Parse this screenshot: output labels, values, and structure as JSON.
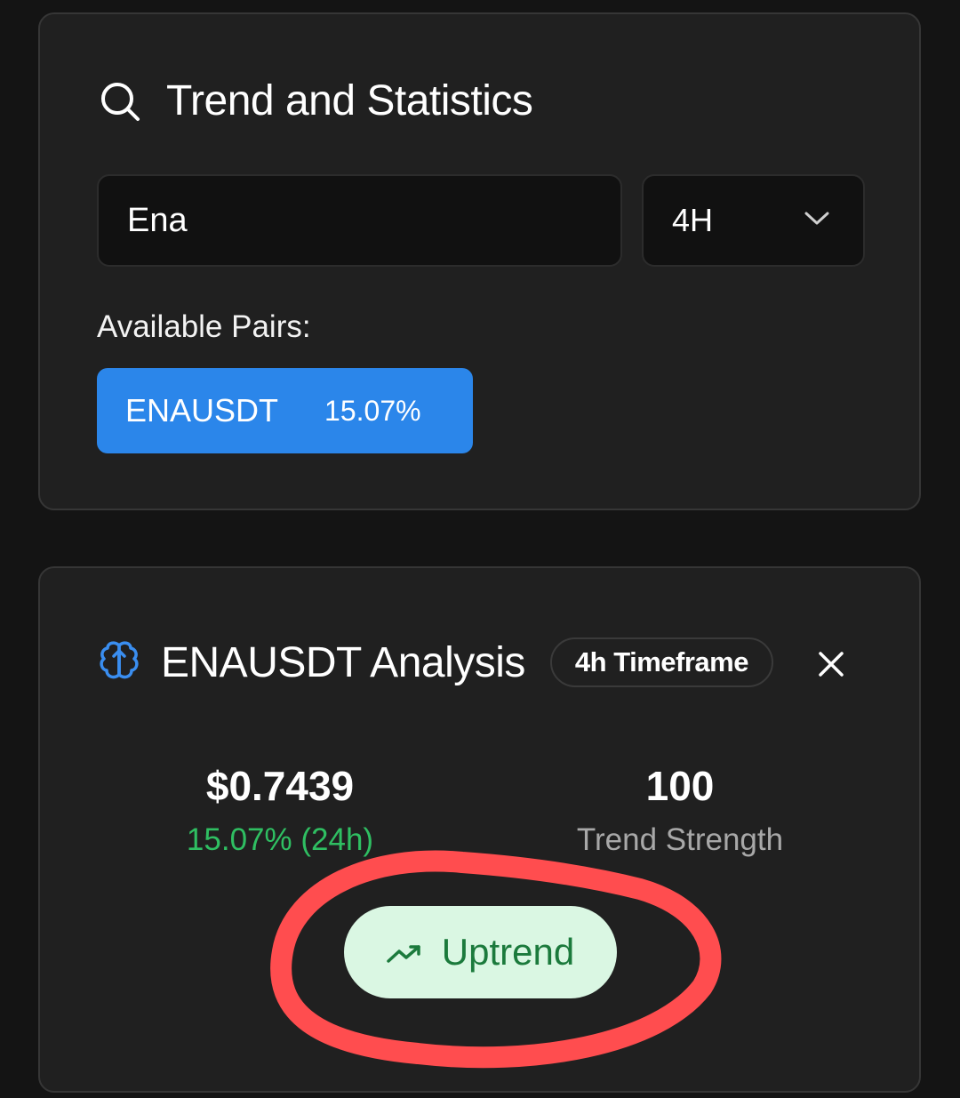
{
  "search_card": {
    "title": "Trend and Statistics",
    "icon": "search-icon",
    "symbol_input_value": "Ena",
    "timeframe_value": "4H",
    "pairs_label": "Available Pairs:",
    "pairs": [
      {
        "symbol": "ENAUSDT",
        "change": "15.07%"
      }
    ]
  },
  "analysis_card": {
    "icon": "brain-icon",
    "title": "ENAUSDT Analysis",
    "timeframe_badge": "4h Timeframe",
    "price": "$0.7439",
    "price_change": "15.07% (24h)",
    "trend_strength_value": "100",
    "trend_strength_label": "Trend Strength",
    "trend_label": "Uptrend",
    "trend_icon": "trending-up-icon"
  },
  "colors": {
    "background": "#141414",
    "card": "#202020",
    "accent_blue": "#2b86ea",
    "positive_green": "#2fbf62",
    "uptrend_bg": "#daf7e3",
    "uptrend_text": "#1b7a3c",
    "annotation_red": "#ff4d4f"
  }
}
